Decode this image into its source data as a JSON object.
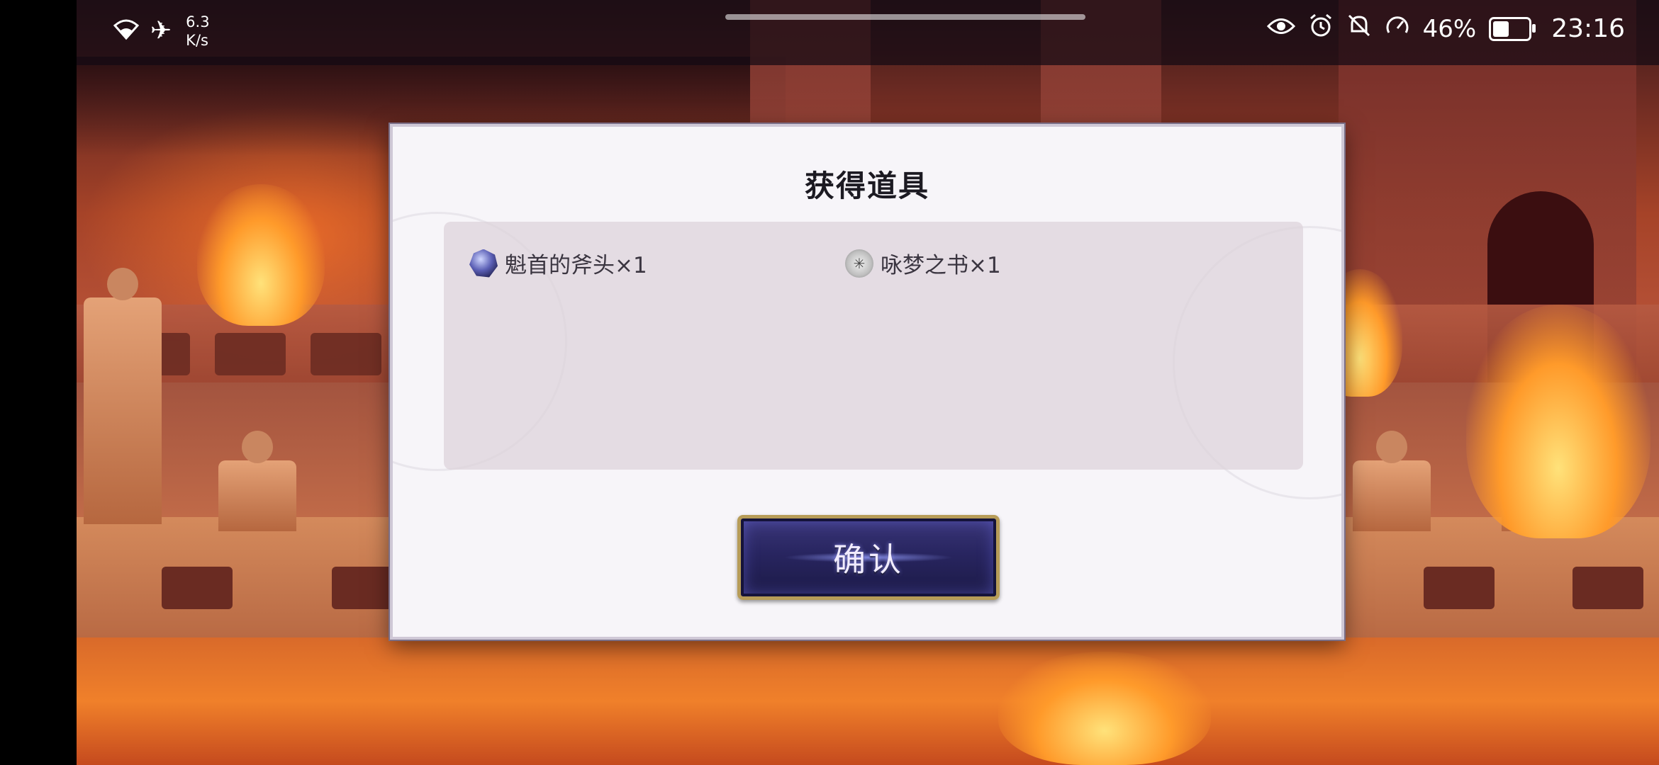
{
  "status_bar": {
    "net_speed_value": "6.3",
    "net_speed_unit": "K/s",
    "battery_percent": "46%",
    "battery_level": 0.46,
    "time": "23:16",
    "icons": [
      "wifi-icon",
      "airplane-mode-icon",
      "eye-comfort-icon",
      "alarm-icon",
      "mute-icon",
      "speedometer-icon",
      "battery-icon"
    ]
  },
  "dialog": {
    "title": "获得道具",
    "items": [
      {
        "icon": "axe-icon",
        "label": "魁首的斧头×1"
      },
      {
        "icon": "book-icon",
        "label": "咏梦之书×1"
      }
    ],
    "confirm_label": "确认"
  },
  "colors": {
    "dialog_bg": "#f7f5f9",
    "panel_bg": "#dcd2da",
    "button_bg": "#282560",
    "button_border": "#b79c58"
  }
}
